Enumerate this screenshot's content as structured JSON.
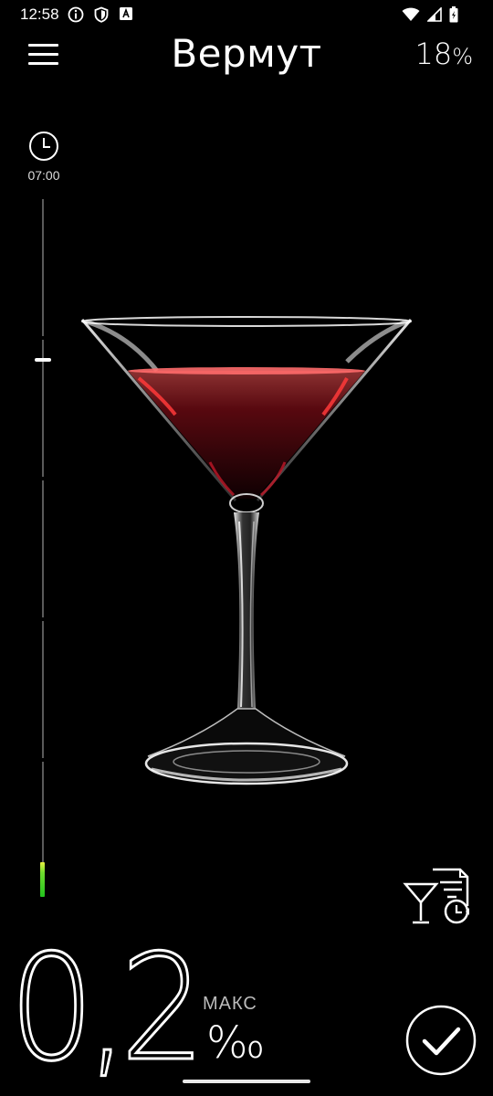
{
  "status_bar": {
    "time": "12:58",
    "left_icons": [
      "info-icon",
      "shield-icon",
      "a-badge-icon"
    ],
    "right_icons": [
      "wifi-icon",
      "signal-icon",
      "battery-icon"
    ]
  },
  "header": {
    "title": "Вермут",
    "strength_value": "18",
    "strength_unit": "%"
  },
  "timeline": {
    "time": "07:00",
    "level_fraction": 0.05
  },
  "result": {
    "value": "0,2",
    "max_label": "МАКС",
    "unit": "‰"
  },
  "colors": {
    "background": "#000000",
    "accent": "#22c41e",
    "liquid": "#e0303a"
  }
}
